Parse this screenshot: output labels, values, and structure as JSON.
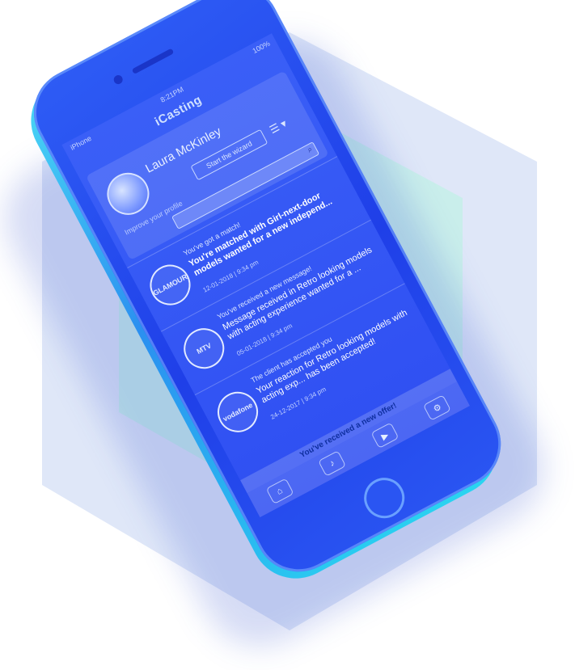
{
  "colors": {
    "phone_body": "#1f3fe8",
    "phone_rim": "#49d7f5",
    "screen": "#3a5ff7",
    "hexagon": "#d9e3f8",
    "cube_cyan": "#a8e6ef"
  },
  "status_bar": {
    "carrier": "iPhone",
    "time": "8:21PM",
    "battery": "100%"
  },
  "app": {
    "title": "iCasting"
  },
  "profile": {
    "name": "Laura McKinley",
    "wizard_button": "Start the wizard",
    "improve_link": "Improve your profile"
  },
  "feed": [
    {
      "logo": "GLAMOUR",
      "header": "You've got a match!",
      "text": "You're matched with Girl-next-door models wanted for a new independ...",
      "date": "12-01-2018 | 9:34 pm",
      "bold": true
    },
    {
      "logo": "MTV",
      "header": "You've received a new message!",
      "text": "Message received in Retro looking models with acting experience wanted for a ...",
      "date": "05-01-2018 | 9:34 pm",
      "bold": false
    },
    {
      "logo": "vodafone",
      "header": "The client has accepted you",
      "text": "Your reaction for Retro looking models with acting exp... has been accepted!",
      "date": "24-12-2017 | 9:34 pm",
      "bold": false
    }
  ],
  "offer_banner": "You've received a new offer!",
  "tabs": [
    {
      "icon": "briefcase-icon",
      "glyph": "⌂"
    },
    {
      "icon": "bell-icon",
      "glyph": "♪"
    },
    {
      "icon": "video-icon",
      "glyph": "▶"
    },
    {
      "icon": "settings-icon",
      "glyph": "⚙"
    }
  ]
}
